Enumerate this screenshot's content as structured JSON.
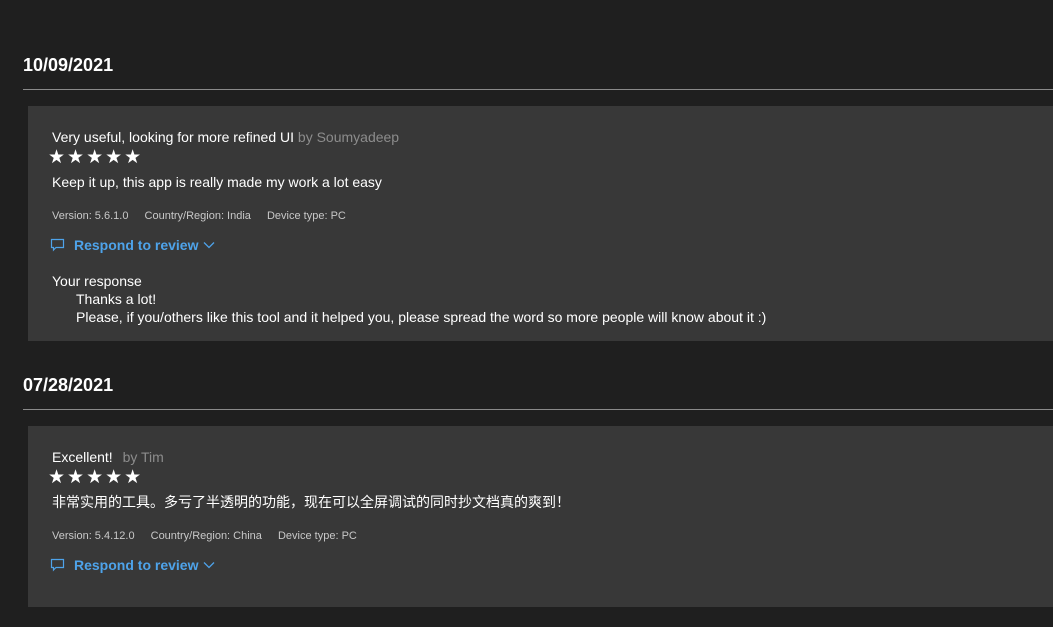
{
  "reviews": [
    {
      "date": "10/09/2021",
      "title": "Very useful, looking for more refined UI",
      "author": "by Soumyadeep",
      "stars": "★★★★★",
      "body": "Keep it up, this app is really made my work a lot easy",
      "version": "Version: 5.6.1.0",
      "region": "Country/Region: India",
      "device": "Device type: PC",
      "respond_label": "Respond to review",
      "response_title": "Your response",
      "response_lines": [
        "Thanks a lot!",
        "Please, if you/others like this tool and it helped you, please spread the word so more people will know about it :)"
      ]
    },
    {
      "date": "07/28/2021",
      "title": "Excellent!",
      "author": "by Tim",
      "stars": "★★★★★",
      "body": "非常实用的工具。多亏了半透明的功能，现在可以全屏调试的同时抄文档真的爽到！",
      "version": "Version: 5.4.12.0",
      "region": "Country/Region: China",
      "device": "Device type: PC",
      "respond_label": "Respond to review"
    }
  ],
  "colors": {
    "background": "#1f1f1f",
    "card": "#383838",
    "accent": "#4ea3ea",
    "author": "#8c8c8c"
  },
  "icons": {
    "respond": "chat-bubble-icon",
    "expand": "chevron-down-icon",
    "rating": "star-icon"
  }
}
